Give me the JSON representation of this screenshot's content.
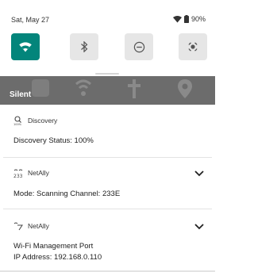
{
  "status_bar": {
    "date": "Sat, May 27",
    "battery": "90%"
  },
  "quick_settings": {
    "tiles": [
      {
        "name": "wifi",
        "icon": "wifi-icon",
        "active": true
      },
      {
        "name": "bluetooth",
        "icon": "bluetooth-icon",
        "active": false
      },
      {
        "name": "do-not-disturb",
        "icon": "do-not-disturb-icon",
        "active": false
      },
      {
        "name": "location",
        "icon": "location-icon",
        "active": false
      }
    ],
    "accent": "#03857b"
  },
  "section": {
    "label": "Silent"
  },
  "notifications": [
    {
      "app": "Discovery",
      "icon": "discovery-icon",
      "title": "Discovery Status: 100%",
      "expandable": false
    },
    {
      "app": "NetAlly",
      "icon": "channel-icon",
      "title": "Mode: Scanning Channel: 233E",
      "expandable": true
    },
    {
      "app": "NetAlly",
      "icon": "netally-icon",
      "title": "Wi-Fi Management Port",
      "subtitle": "IP Address: 192.168.0.110",
      "expandable": true
    }
  ]
}
